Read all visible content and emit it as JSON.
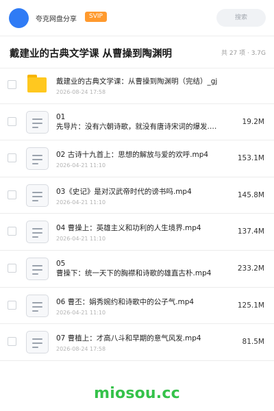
{
  "header": {
    "app_name": "夸克网盘分享",
    "badge": "SVIP",
    "search_placeholder": "搜索",
    "colors": {
      "logo": "#2f7bf5",
      "badge": "#ff9a2e"
    }
  },
  "folder": {
    "title": "戴建业的古典文学课 从曹操到陶渊明",
    "meta": "共 27 项 · 3.7G"
  },
  "items": [
    {
      "type": "folder",
      "icon": "folder-icon",
      "name": "戴建业的古典文学课：从曹操到陶渊明（完结）_gj",
      "date": "2026-08-24 17:58",
      "size": ""
    },
    {
      "type": "file",
      "icon": "file-icon",
      "name_line1": "01",
      "name_line2": "先导片：没有六朝诗歌，就没有唐诗宋词的爆发.…",
      "date": "2026-04-21 11:10",
      "size": "19.2M"
    },
    {
      "type": "file",
      "icon": "file-icon",
      "name": "02 古诗十九首上：思想的解放与爱的欢呼.mp4",
      "date": "2026-04-21 11:10",
      "size": "153.1M"
    },
    {
      "type": "file",
      "icon": "file-icon",
      "name": "03《史记》是对汉武帝时代的谤书吗.mp4",
      "date": "2026-04-21 11:10",
      "size": "145.8M"
    },
    {
      "type": "file",
      "icon": "file-icon",
      "name": "04 曹操上：英雄主义和功利的人生境界.mp4",
      "date": "2026-04-21 11:10",
      "size": "137.4M"
    },
    {
      "type": "file",
      "icon": "file-icon",
      "name_line1": "05",
      "name_line2": "曹操下：统一天下的胸襟和诗歌的雄直古朴.mp4",
      "date": "2026-04-21 11:10",
      "size": "233.2M"
    },
    {
      "type": "file",
      "icon": "file-icon",
      "name": "06 曹丕：娟秀婉约和诗歌中的公子气.mp4",
      "date": "2026-04-21 11:10",
      "size": "125.1M"
    },
    {
      "type": "file",
      "icon": "file-icon",
      "name": "07 曹植上：才高八斗和早期的意气风发.mp4",
      "date": "2026-08-24 17:58",
      "size": "81.5M"
    }
  ],
  "watermark": "miosou.cc"
}
